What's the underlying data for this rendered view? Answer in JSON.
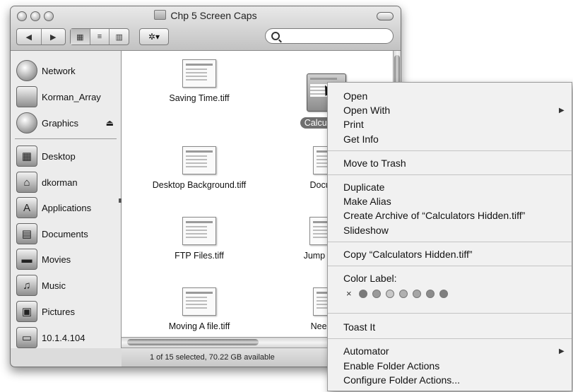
{
  "window": {
    "title": "Chp 5 Screen Caps",
    "toolbar": {
      "back_glyph": "◀",
      "forward_glyph": "▶",
      "view_icon_glyph": "▦",
      "view_list_glyph": "≡",
      "view_column_glyph": "▥",
      "action_glyph": "✲▾",
      "search_placeholder": ""
    }
  },
  "sidebar": {
    "devices": [
      {
        "label": "Network",
        "icon": "network-globe-icon"
      },
      {
        "label": "Korman_Array",
        "icon": "hard-drive-icon"
      },
      {
        "label": "Graphics",
        "icon": "disk-icon",
        "eject": "⏏"
      }
    ],
    "places": [
      {
        "label": "Desktop",
        "icon": "desktop-icon",
        "glyph": "▦"
      },
      {
        "label": "dkorman",
        "icon": "home-icon",
        "glyph": "⌂"
      },
      {
        "label": "Applications",
        "icon": "applications-icon",
        "glyph": "A"
      },
      {
        "label": "Documents",
        "icon": "documents-icon",
        "glyph": "▤"
      },
      {
        "label": "Movies",
        "icon": "movies-icon",
        "glyph": "▬"
      },
      {
        "label": "Music",
        "icon": "music-icon",
        "glyph": "♫"
      },
      {
        "label": "Pictures",
        "icon": "pictures-icon",
        "glyph": "▣"
      },
      {
        "label": "10.1.4.104",
        "icon": "server-icon",
        "glyph": "▭"
      }
    ]
  },
  "files": [
    {
      "name": "Saving Time.tiff"
    },
    {
      "name": "Calculators",
      "selected": true
    },
    {
      "name": "Desktop Background.tiff"
    },
    {
      "name": "Document"
    },
    {
      "name": "FTP Files.tiff"
    },
    {
      "name": "Jump To Th"
    },
    {
      "name": "Moving A file.tiff"
    },
    {
      "name": "Need The"
    }
  ],
  "status": {
    "text": "1 of 15 selected, 70.22 GB available"
  },
  "context_menu": {
    "open": "Open",
    "open_with": "Open With",
    "print": "Print",
    "get_info": "Get Info",
    "move_to_trash": "Move to Trash",
    "duplicate": "Duplicate",
    "make_alias": "Make Alias",
    "create_archive": "Create Archive of “Calculators Hidden.tiff”",
    "slideshow": "Slideshow",
    "copy": "Copy “Calculators Hidden.tiff”",
    "color_label": "Color Label:",
    "no_label_glyph": "×",
    "label_colors": [
      "#7a7a7a",
      "#9a9a9a",
      "#c8c8c8",
      "#b0b0b0",
      "#a6a6a6",
      "#8c8c8c",
      "#7f7f7f"
    ],
    "toast_it": "Toast It",
    "automator": "Automator",
    "enable_folder_actions": "Enable Folder Actions",
    "configure_folder_actions": "Configure Folder Actions..."
  }
}
